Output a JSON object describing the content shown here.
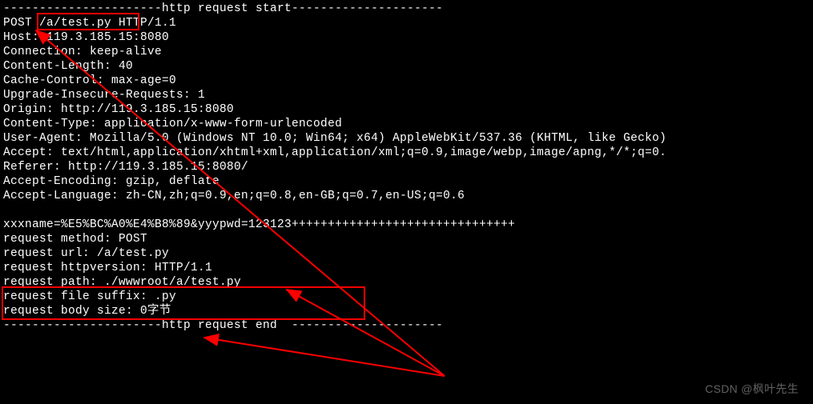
{
  "terminal": {
    "lines": [
      "----------------------http request start---------------------",
      "POST /a/test.py HTTP/1.1",
      "Host: 119.3.185.15:8080",
      "Connection: keep-alive",
      "Content-Length: 40",
      "Cache-Control: max-age=0",
      "Upgrade-Insecure-Requests: 1",
      "Origin: http://119.3.185.15:8080",
      "Content-Type: application/x-www-form-urlencoded",
      "User-Agent: Mozilla/5.0 (Windows NT 10.0; Win64; x64) AppleWebKit/537.36 (KHTML, like Gecko)",
      "Accept: text/html,application/xhtml+xml,application/xml;q=0.9,image/webp,image/apng,*/*;q=0.",
      "Referer: http://119.3.185.15:8080/",
      "Accept-Encoding: gzip, deflate",
      "Accept-Language: zh-CN,zh;q=0.9,en;q=0.8,en-GB;q=0.7,en-US;q=0.6",
      "",
      "xxxname=%E5%BC%A0%E4%B8%89&yyypwd=123123+++++++++++++++++++++++++++++++",
      "request method: POST",
      "request url: /a/test.py",
      "request httpversion: HTTP/1.1",
      "request path: ./wwwroot/a/test.py",
      "request file suffix: .py",
      "request body size: 0字节",
      "----------------------http request end  ---------------------"
    ]
  },
  "annotations": {
    "highlight_path": "/a/test.py",
    "highlight_body": "xxxname=%E5%BC%A0%E4%B8%89&yyypwd=123123 / request method: POST"
  },
  "watermark": "CSDN @枫叶先生"
}
